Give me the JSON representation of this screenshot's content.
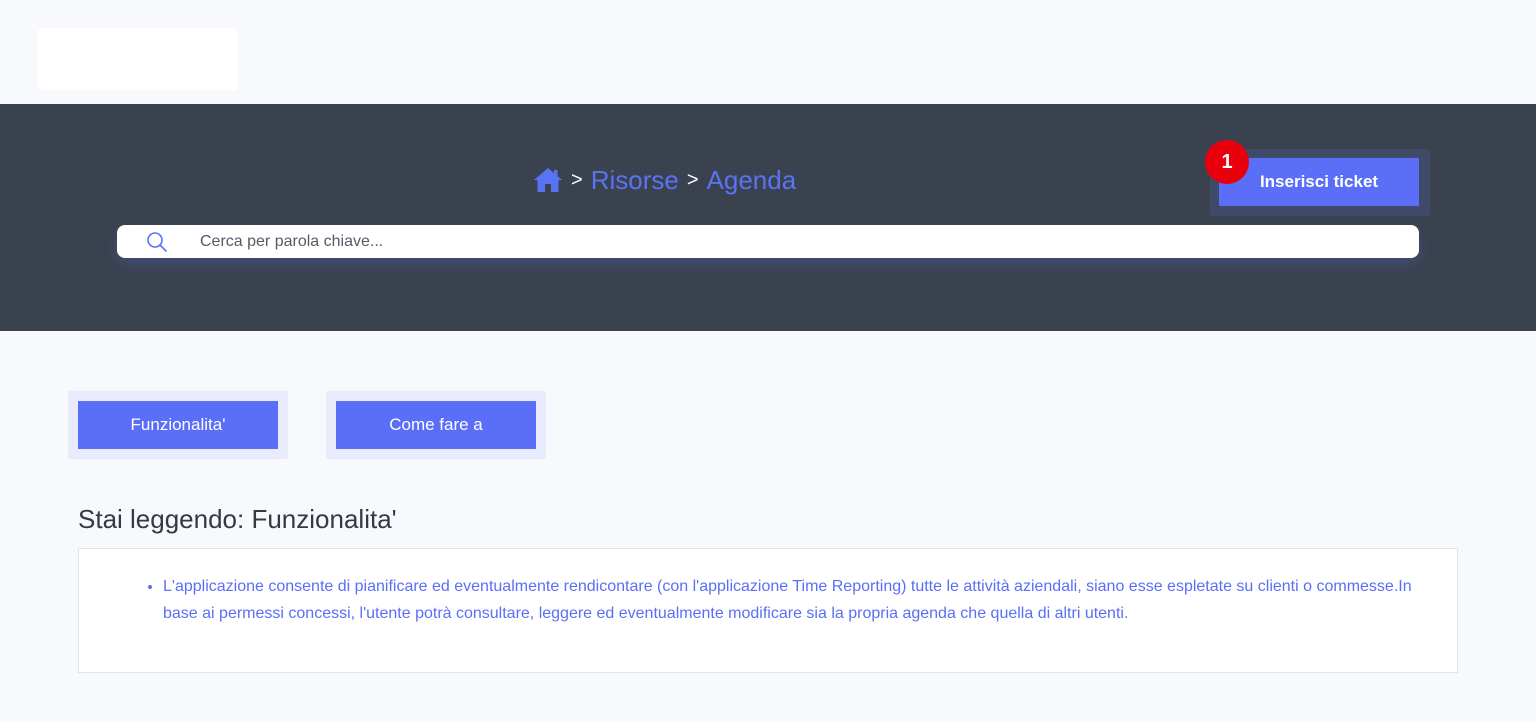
{
  "breadcrumb": {
    "separator": ">",
    "items": [
      "Risorse",
      "Agenda"
    ]
  },
  "header": {
    "ticket_label": "Inserisci ticket",
    "badge": "1"
  },
  "search": {
    "placeholder": "Cerca per parola chiave...",
    "value": ""
  },
  "tabs": [
    {
      "label": "Funzionalita'"
    },
    {
      "label": "Come fare a"
    }
  ],
  "main": {
    "reading_title": "Stai leggendo: Funzionalita'",
    "items": [
      "L'applicazione consente di pianificare ed eventualmente rendicontare (con l'applicazione Time Reporting) tutte le attività aziendali, siano esse espletate su clienti o commesse.In base ai permessi concessi, l'utente potrà consultare, leggere ed eventualmente modificare sia la propria agenda che quella di altri utenti."
    ]
  },
  "colors": {
    "accent": "#5a6ef8",
    "hero_bg": "#39424e",
    "badge": "#e8000d"
  },
  "icons": {
    "home": "home-icon",
    "search": "search-icon"
  }
}
